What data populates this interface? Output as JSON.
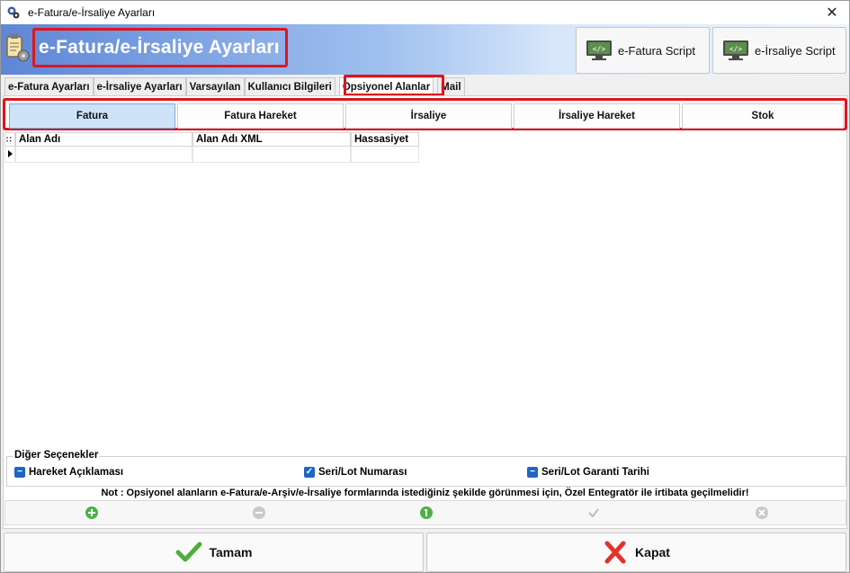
{
  "window": {
    "title": "e-Fatura/e-İrsaliye Ayarları",
    "close": "✕"
  },
  "header": {
    "title": "e-Fatura/e-İrsaliye Ayarları",
    "efatura_script": "e-Fatura Script",
    "eirsaliye_script": "e-İrsaliye Script"
  },
  "tabs": [
    {
      "label": "e-Fatura Ayarları"
    },
    {
      "label": "e-İrsaliye Ayarları"
    },
    {
      "label": "Varsayılan"
    },
    {
      "label": "Kullanıcı Bilgileri"
    },
    {
      "label": "Opsiyonel Alanlar"
    },
    {
      "label": "Mail"
    }
  ],
  "subtabs": [
    {
      "label": "Fatura"
    },
    {
      "label": "Fatura Hareket"
    },
    {
      "label": "İrsaliye"
    },
    {
      "label": "İrsaliye Hareket"
    },
    {
      "label": "Stok"
    }
  ],
  "grid": {
    "columns": [
      "Alan Adı",
      "Alan Adı XML",
      "Hassasiyet"
    ]
  },
  "options": {
    "title": "Diğer Seçenekler",
    "items": [
      {
        "label": "Hareket Açıklaması",
        "state": "indeterminate"
      },
      {
        "label": "Seri/Lot Numarası",
        "state": "checked"
      },
      {
        "label": "Seri/Lot Garanti Tarihi",
        "state": "indeterminate"
      }
    ]
  },
  "note": "Not : Opsiyonel alanların e-Fatura/e-Arşiv/e-İrsaliye formlarında istediğiniz şekilde görünmesi için, Özel Entegratör ile irtibata geçilmelidir!",
  "buttons": {
    "ok": "Tamam",
    "close": "Kapat"
  },
  "colors": {
    "highlight": "#e0141c",
    "accent": "#1e66c4",
    "header_start": "#5e86d6"
  }
}
